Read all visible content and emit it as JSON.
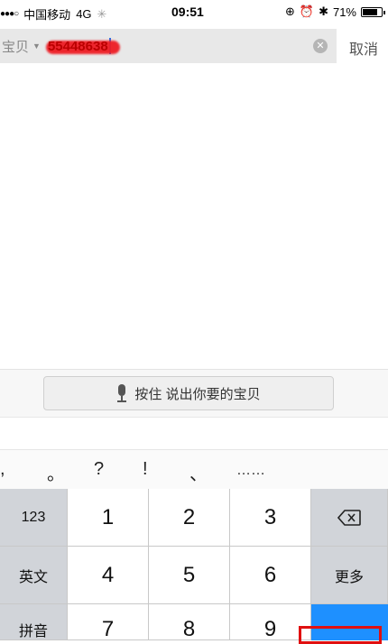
{
  "status_bar": {
    "signal": "●●●○",
    "carrier": "中国移动",
    "network": "4G",
    "time": "09:51",
    "battery_percent": "71%"
  },
  "search": {
    "scope": "宝贝",
    "query": "55448638",
    "clear_icon": "clear-icon",
    "cancel_label": "取消"
  },
  "voice": {
    "label": "按住 说出你要的宝贝",
    "icon": "microphone-icon"
  },
  "punctuation": [
    ",",
    "。",
    "?",
    "!",
    "、",
    "……"
  ],
  "keyboard": {
    "left_keys": [
      "123",
      "英文",
      "拼音"
    ],
    "digits": [
      "1",
      "2",
      "3",
      "4",
      "5",
      "6",
      "7",
      "8",
      "9"
    ],
    "more_label": "更多",
    "backspace_icon": "backspace-icon",
    "go_color": "#1e90ff",
    "highlight_color": "#e01010"
  }
}
